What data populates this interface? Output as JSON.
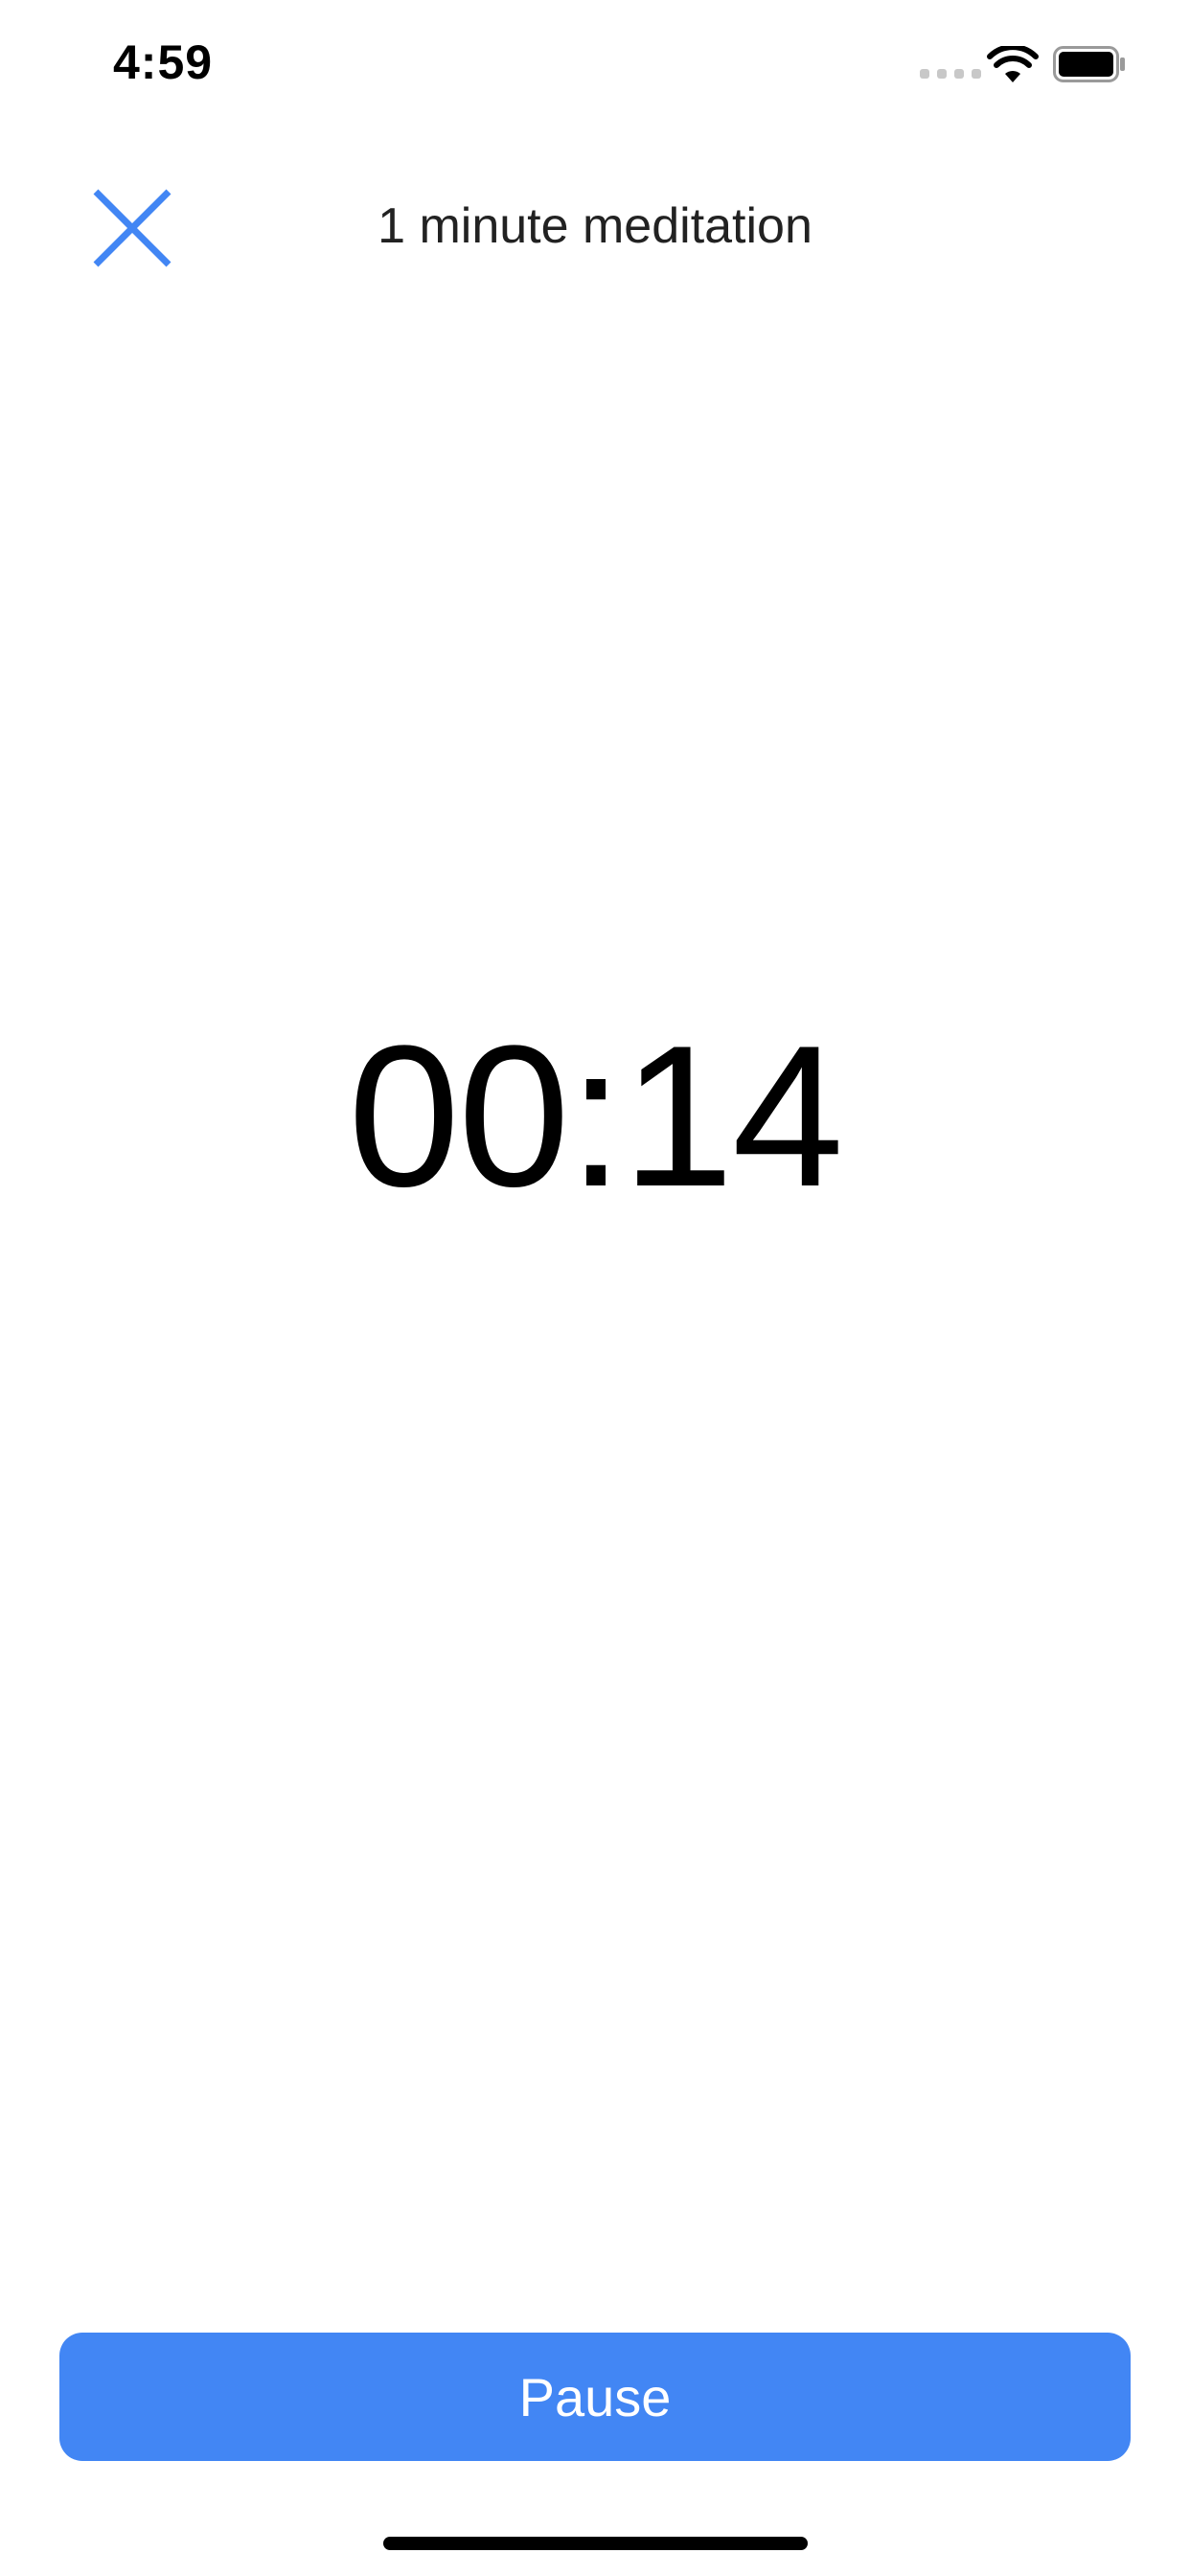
{
  "status_bar": {
    "time": "4:59",
    "signal_icon": "cellular-signal-icon",
    "wifi_icon": "wifi-icon",
    "battery_icon": "battery-icon"
  },
  "nav": {
    "title": "1 minute meditation",
    "close_icon": "close-icon"
  },
  "timer": {
    "display": "00:14"
  },
  "actions": {
    "pause_label": "Pause"
  },
  "colors": {
    "accent": "#4286F4",
    "background": "#FFFFFF",
    "text": "#000000"
  }
}
